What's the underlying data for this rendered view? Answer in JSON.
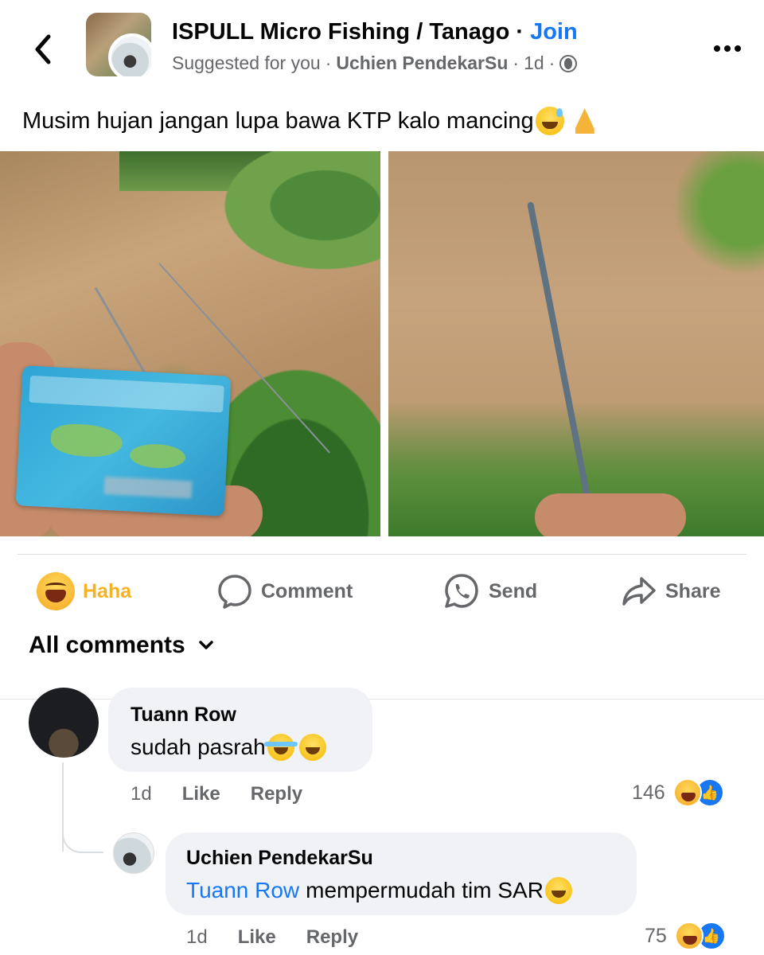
{
  "header": {
    "group_name": "ISPULL Micro Fishing / Tanago",
    "separator": " · ",
    "join_label": "Join",
    "suggested": "Suggested for you",
    "dot": "·",
    "author": "Uchien PendekarSu",
    "time": "1d",
    "icons": {
      "back": "chevron-left-icon",
      "more": "more-horizontal-icon",
      "privacy": "globe-icon"
    }
  },
  "post": {
    "caption": "Musim hujan jangan lupa bawa KTP kalo mancing",
    "caption_emojis": [
      "grinning-sweat-emoji",
      "folded-hands-emoji"
    ],
    "photos": [
      "ktp-card-by-river-photo",
      "fishing-rod-in-river-photo"
    ]
  },
  "actions": {
    "haha": "Haha",
    "comment": "Comment",
    "send": "Send",
    "share": "Share"
  },
  "comments_header": {
    "label": "All comments"
  },
  "comments": [
    {
      "name": "Tuann Row",
      "text": "sudah pasrah",
      "time": "1d",
      "like": "Like",
      "reply": "Reply",
      "reaction_count": "146"
    },
    {
      "name": "Uchien PendekarSu",
      "mention": "Tuann Row",
      "text": "mempermudah tim SAR",
      "time": "1d",
      "like": "Like",
      "reply": "Reply",
      "reaction_count": "75"
    }
  ],
  "colors": {
    "accent": "#1877f2",
    "haha": "#f7b125",
    "muted": "#65676b",
    "bubble": "#f0f2f5"
  }
}
